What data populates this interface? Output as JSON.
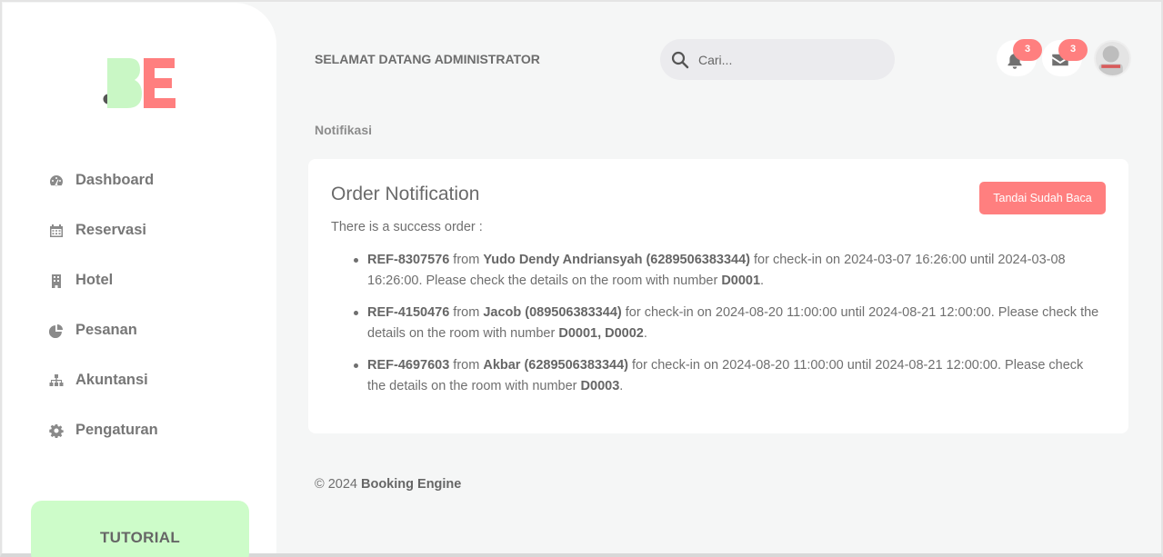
{
  "brand": {
    "logo_text": "BE"
  },
  "sidebar": {
    "items": [
      {
        "label": "Dashboard",
        "icon": "dashboard-icon"
      },
      {
        "label": "Reservasi",
        "icon": "calendar-icon"
      },
      {
        "label": "Hotel",
        "icon": "building-icon"
      },
      {
        "label": "Pesanan",
        "icon": "pie-chart-icon"
      },
      {
        "label": "Akuntansi",
        "icon": "sitemap-icon"
      },
      {
        "label": "Pengaturan",
        "icon": "gear-icon"
      }
    ],
    "tutorial_label": "TUTORIAL"
  },
  "header": {
    "welcome": "SELAMAT DATANG ADMINISTRATOR",
    "search_placeholder": "Cari...",
    "notification_count": "3",
    "message_count": "3"
  },
  "breadcrumb": "Notifikasi",
  "card": {
    "title": "Order Notification",
    "mark_read_label": "Tandai Sudah Baca",
    "intro": "There is a success order :",
    "orders": [
      {
        "ref": "REF-8307576",
        "from_word": " from ",
        "guest": "Yudo Dendy Andriansyah (6289506383344)",
        "middle": " for check-in on 2024-03-07 16:26:00 until 2024-03-08 16:26:00. Please check the details on the room with number ",
        "room": "D0001",
        "end": "."
      },
      {
        "ref": "REF-4150476",
        "from_word": " from ",
        "guest": "Jacob (089506383344)",
        "middle": " for check-in on 2024-08-20 11:00:00 until 2024-08-21 12:00:00. Please check the details on the room with number ",
        "room": "D0001, D0002",
        "end": "."
      },
      {
        "ref": "REF-4697603",
        "from_word": " from ",
        "guest": "Akbar (6289506383344)",
        "middle": " for check-in on 2024-08-20 11:00:00 until 2024-08-21 12:00:00. Please check the details on the room with number ",
        "room": "D0003",
        "end": "."
      }
    ]
  },
  "footer": {
    "copyright": "© 2024 ",
    "brand": "Booking Engine"
  },
  "colors": {
    "accent_red": "#ff7f7f",
    "accent_green": "#cdfcc9",
    "logo_green": "#c9f7c5"
  }
}
